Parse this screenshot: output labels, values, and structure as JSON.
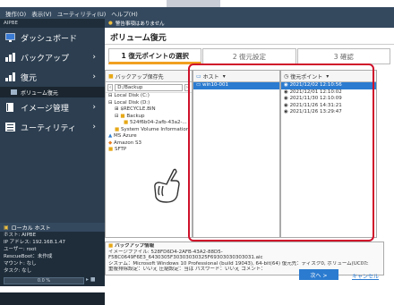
{
  "menubar": {
    "items": [
      "操作(O)",
      "表示(V)",
      "ユーティリティ(U)",
      "ヘルプ(H)"
    ]
  },
  "sidebar": {
    "title": "AIPBE",
    "items": [
      {
        "label": "ダッシュボード",
        "icon": "monitor-icon"
      },
      {
        "label": "バックアップ",
        "icon": "chart-icon"
      },
      {
        "label": "復元",
        "icon": "restore-icon"
      },
      {
        "label": "ボリューム復元",
        "icon": "volume-icon"
      },
      {
        "label": "イメージ管理",
        "icon": "book-icon"
      },
      {
        "label": "ユーティリティ",
        "icon": "list-icon"
      }
    ],
    "local_host": {
      "title": "ローカル ホスト",
      "rows": [
        "ホスト:        AIPBE",
        "IP アドレス:  192.168.1.47",
        "ユーザー:      root",
        "RescueBoot：未作成",
        "マウント:      なし",
        "タスク: なし"
      ],
      "progress": "0.0 %"
    }
  },
  "main": {
    "notice": "警告事項はありません",
    "title": "ボリューム復元",
    "steps": [
      "1  復元ポイントの選択",
      "2  復元設定",
      "3  確認"
    ],
    "backup_pane": {
      "header": "バックアップ保存先",
      "path": "D:/Backup",
      "tree": [
        "Local Disk (C:)",
        "Local Disk (D:)",
        "$RECYCLE.BIN",
        "Backup",
        "524f6b04-2afb-43a2-...",
        "System Volume Information",
        "MS Azure",
        "Amazon S3",
        "SFTP"
      ]
    },
    "host_pane": {
      "header": "ホスト",
      "items": [
        "win10-001"
      ]
    },
    "points_pane": {
      "header": "復元ポイント",
      "items": [
        "2021/12/02 12:10:56",
        "2021/12/01 12:10:02",
        "2021/11/30 12:10:09",
        "2021/11/26 14:31:21",
        "2021/11/26 13:29:47"
      ]
    },
    "info": {
      "header": "バックアップ情報",
      "lines": [
        "イメージファイル: 528FD6D4-2AFB-43A2-88D5-",
        "F5BC0649F6E3_6430305F30303030325F69303030303031.aic",
        "システム：Microsoft Windows 10 Professional (build 19043), 64-bit(64) 復元先：ディスク0, ボリューム(UC0た",
        "重複排除設定：いいえ 圧縮設定：当は パスワード：いいえ コメント："
      ]
    },
    "next_label": "次へ >",
    "cancel_label": "キャンセル"
  },
  "colors": {
    "accent": "#2b7bd0",
    "highlight": "#d0112b",
    "sidebar": "#2c3e50"
  }
}
